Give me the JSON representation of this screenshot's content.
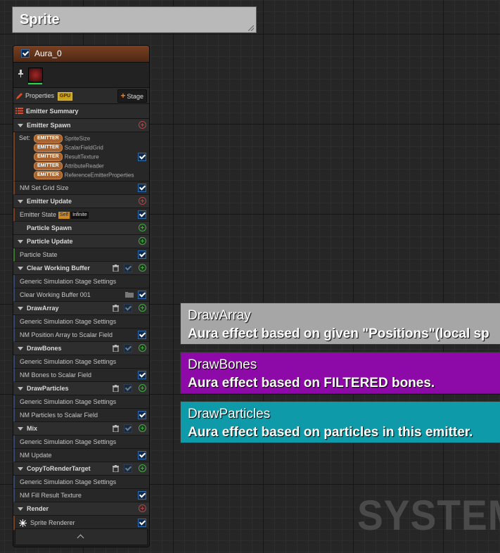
{
  "comment_box": {
    "title": "Sprite"
  },
  "emitter": {
    "name": "Aura_0",
    "properties_label": "Properties",
    "gpu_badge": "GPU",
    "stage_button": "Stage",
    "summary_label": "Emitter Summary",
    "sections": {
      "emitter_spawn": "Emitter Spawn",
      "set_label": "Set:",
      "set_tag": "EMITTER",
      "set_items": [
        "SpriteSize",
        "ScalarFieldGrid",
        "ResultTexture",
        "AttributeReader",
        "ReferenceEmitterProperties"
      ],
      "nm_set_grid_size": "NM Set Grid Size",
      "emitter_update": "Emitter Update",
      "emitter_state": "Emitter State",
      "self_tag": "Self",
      "infinite_tag": "Infinite",
      "particle_spawn": "Particle Spawn",
      "particle_update": "Particle Update",
      "particle_state": "Particle State",
      "clear_working_buffer": "Clear Working Buffer",
      "generic_sim_stage": "Generic Simulation Stage Settings",
      "clear_working_buffer_001": "Clear Working Buffer 001",
      "draw_array": "DrawArray",
      "nm_position_array": "NM Position Array to Scalar Field",
      "draw_bones": "DrawBones",
      "nm_bones": "NM Bones to Scalar Field",
      "draw_particles": "DrawParticles",
      "nm_particles": "NM Particles to Scalar Field",
      "mix": "Mix",
      "nm_update": "NM Update",
      "copy_to_render_target": "CopyToRenderTarget",
      "nm_fill_result": "NM Fill Result Texture",
      "render": "Render",
      "sprite_renderer": "Sprite Renderer"
    }
  },
  "notes": [
    {
      "title": "DrawArray",
      "text": "Aura effect based on given \"Positions\"(local sp",
      "color": "#a6a6a6"
    },
    {
      "title": "DrawBones",
      "text": "Aura effect based on FILTERED bones.",
      "color": "#8e0aa8"
    },
    {
      "title": "DrawParticles",
      "text": "Aura effect based on particles in this emitter.",
      "color": "#0e9aa8"
    }
  ],
  "watermark": "SYSTEM",
  "colors": {
    "emitter_header": "#7a4020",
    "accent_blue": "#2d6bb0",
    "add_green": "#3fae3f",
    "add_red": "#b04848"
  }
}
